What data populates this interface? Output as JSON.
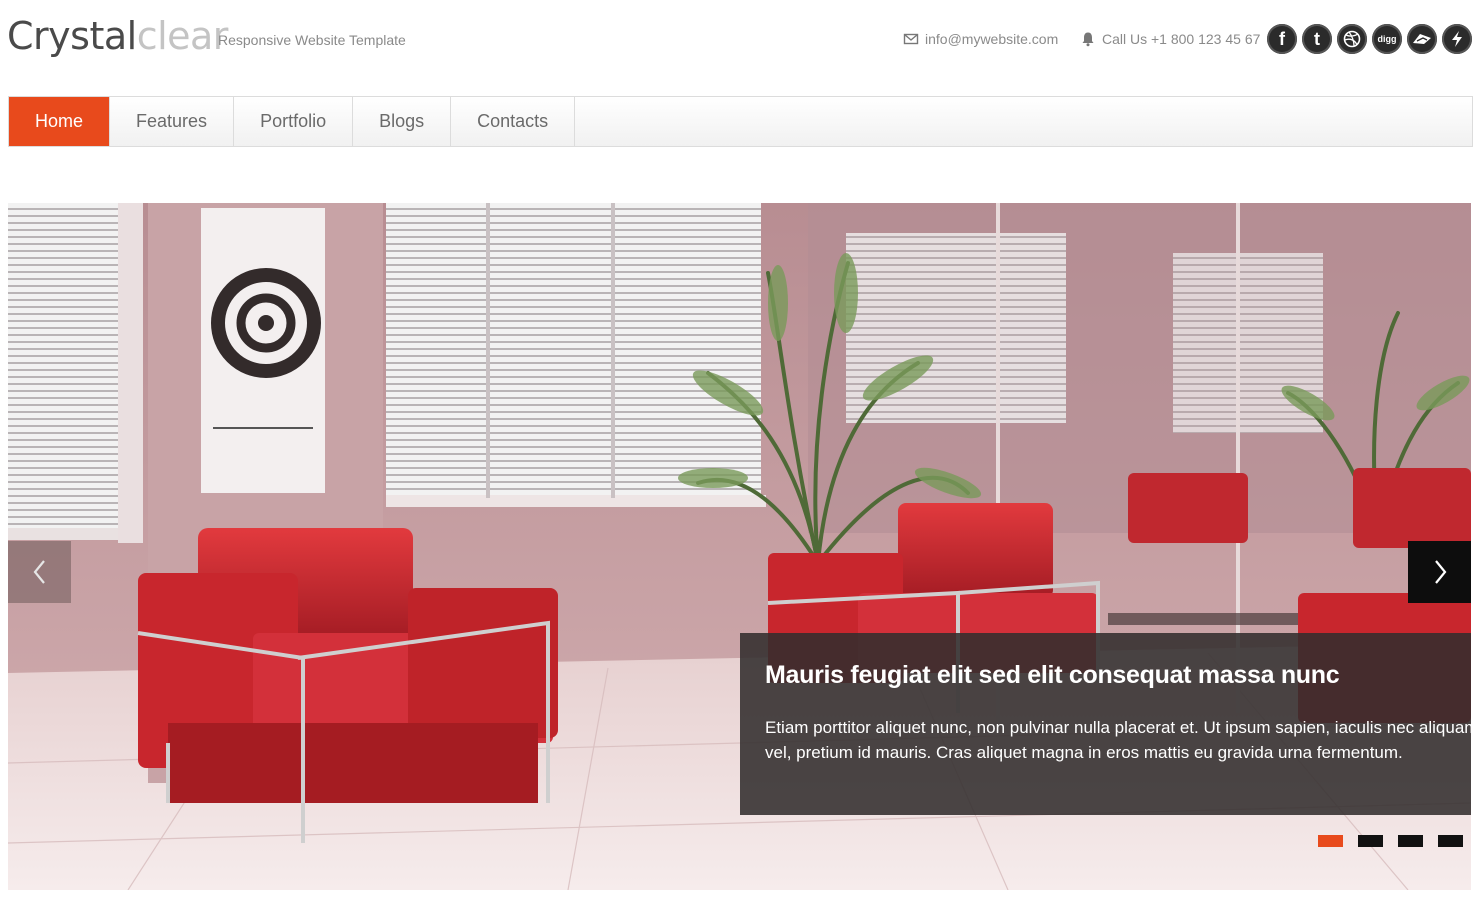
{
  "logo": {
    "part1": "Crystal",
    "part2": "clear"
  },
  "tagline": "Responsive Website Template",
  "contact": {
    "email": "info@mywebsite.com",
    "phone": "Call Us +1 800 123 45 67",
    "email_icon": "envelope-icon",
    "phone_icon": "bell-icon"
  },
  "socials": [
    {
      "name": "facebook",
      "glyph": "f"
    },
    {
      "name": "tumblr",
      "glyph": "t"
    },
    {
      "name": "dribbble",
      "glyph": ""
    },
    {
      "name": "digg",
      "glyph": "digg"
    },
    {
      "name": "delicious",
      "glyph": ""
    },
    {
      "name": "flash",
      "glyph": ""
    }
  ],
  "nav": {
    "items": [
      {
        "label": "Home",
        "active": true
      },
      {
        "label": "Features",
        "active": false
      },
      {
        "label": "Portfolio",
        "active": false
      },
      {
        "label": "Blogs",
        "active": false
      },
      {
        "label": "Contacts",
        "active": false
      }
    ]
  },
  "slider": {
    "caption_title": "Mauris feugiat elit sed elit consequat massa nunc",
    "caption_text": "Etiam porttitor aliquet nunc, non pulvinar nulla placerat et. Ut ipsum sapien, iaculis nec aliquam vel, pretium id mauris. Cras aliquet magna in eros mattis eu gravida urna fermentum.",
    "slide_count": 4,
    "active_slide": 1,
    "accent": "#e84a1c"
  }
}
